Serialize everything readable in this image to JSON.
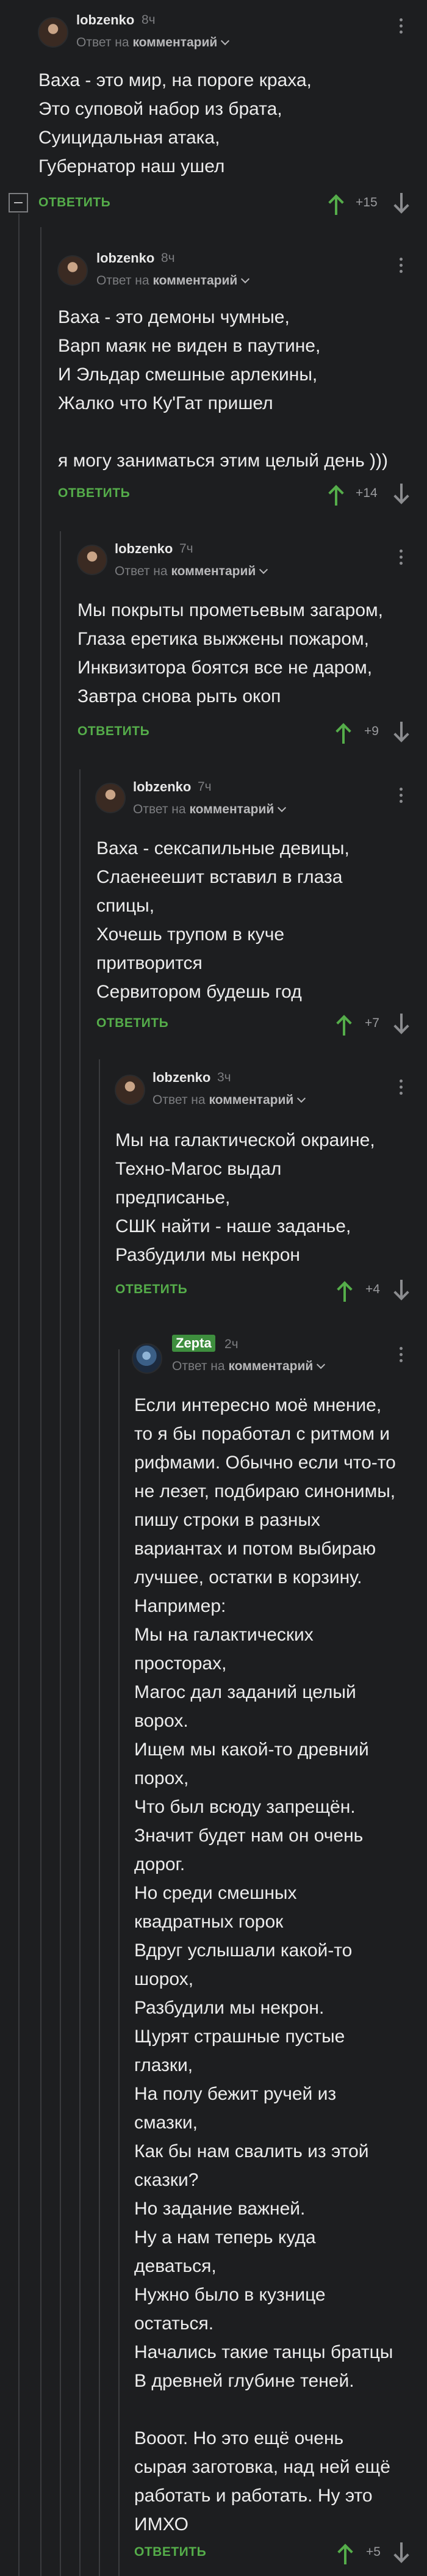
{
  "labels": {
    "reply_to_prefix": "Ответ на",
    "reply_to_target": "комментарий",
    "reply_button": "ОТВЕТИТЬ"
  },
  "comments": [
    {
      "author": "lobzenko",
      "time": "8ч",
      "show_reply_to": true,
      "text": "Ваха - это мир, на пороге краха,\nЭто суповой набор из брата,\nСуицидальная атака,\nГубернатор наш ушел",
      "rating": "+15"
    },
    {
      "author": "lobzenko",
      "time": "8ч",
      "show_reply_to": true,
      "text": "Ваха -  это демоны чумные,\nВарп маяк не виден в паутине,\nИ Эльдар смешные арлекины,\nЖалко что Ку'Гат пришел\n\nя могу заниматься этим целый день )))",
      "rating": "+14"
    },
    {
      "author": "lobzenko",
      "time": "7ч",
      "show_reply_to": true,
      "text": "Мы покрыты прометьевым загаром,\nГлаза еретика выжжены пожаром,\nИнквизитора боятся все не даром,\nЗавтра снова рыть окоп",
      "rating": "+9"
    },
    {
      "author": "lobzenko",
      "time": "7ч",
      "show_reply_to": true,
      "text": "Ваха - сексапильные девицы,\nСлаенеешит вставил в глаза\nспицы,\nХочешь трупом в куче\nпритворится\nСервитором будешь год",
      "rating": "+7"
    },
    {
      "author": "lobzenko",
      "time": "3ч",
      "show_reply_to": true,
      "text": "Мы на галактической окраине,\nТехно-Магос выдал\nпредписанье,\nСШК найти - наше заданье,\nРазбудили мы некрон",
      "rating": "+4"
    },
    {
      "author": "Zepta",
      "time": "2ч",
      "show_reply_to": true,
      "text": "Если интересно моё мнение,\nто я бы поработал с ритмом и\nрифмами. Обычно если что-то\nне лезет, подбираю синонимы,\nпишу строки в разных\nвариантах и потом выбираю\nлучшее, остатки в корзину.\nНапример:\nМы на галактических\nпросторах,\nМагос дал заданий целый\nворох.\nИщем мы какой-то древний\nпорох,\nЧто был всюду запрещён.\nЗначит будет нам он очень\nдорог.\nНо среди смешных\nквадратных горок\nВдруг услышали какой-то\nшорох,\nРазбудили мы некрон.\nЩурят страшные пустые\nглазки,\nНа полу бежит ручей из\nсмазки,\nКак бы нам свалить из этой\nсказки?\nНо задание важней.\nНу а нам теперь куда\nдеваться,\nНужно было в кузнице\nостаться.\nНачались такие танцы братцы\nВ древней глубине теней.\n\nВооот. Но это ещё очень\nсырая заготовка, над ней ещё\nработать и работать. Ну это\nИМХО",
      "rating": "+5"
    }
  ]
}
